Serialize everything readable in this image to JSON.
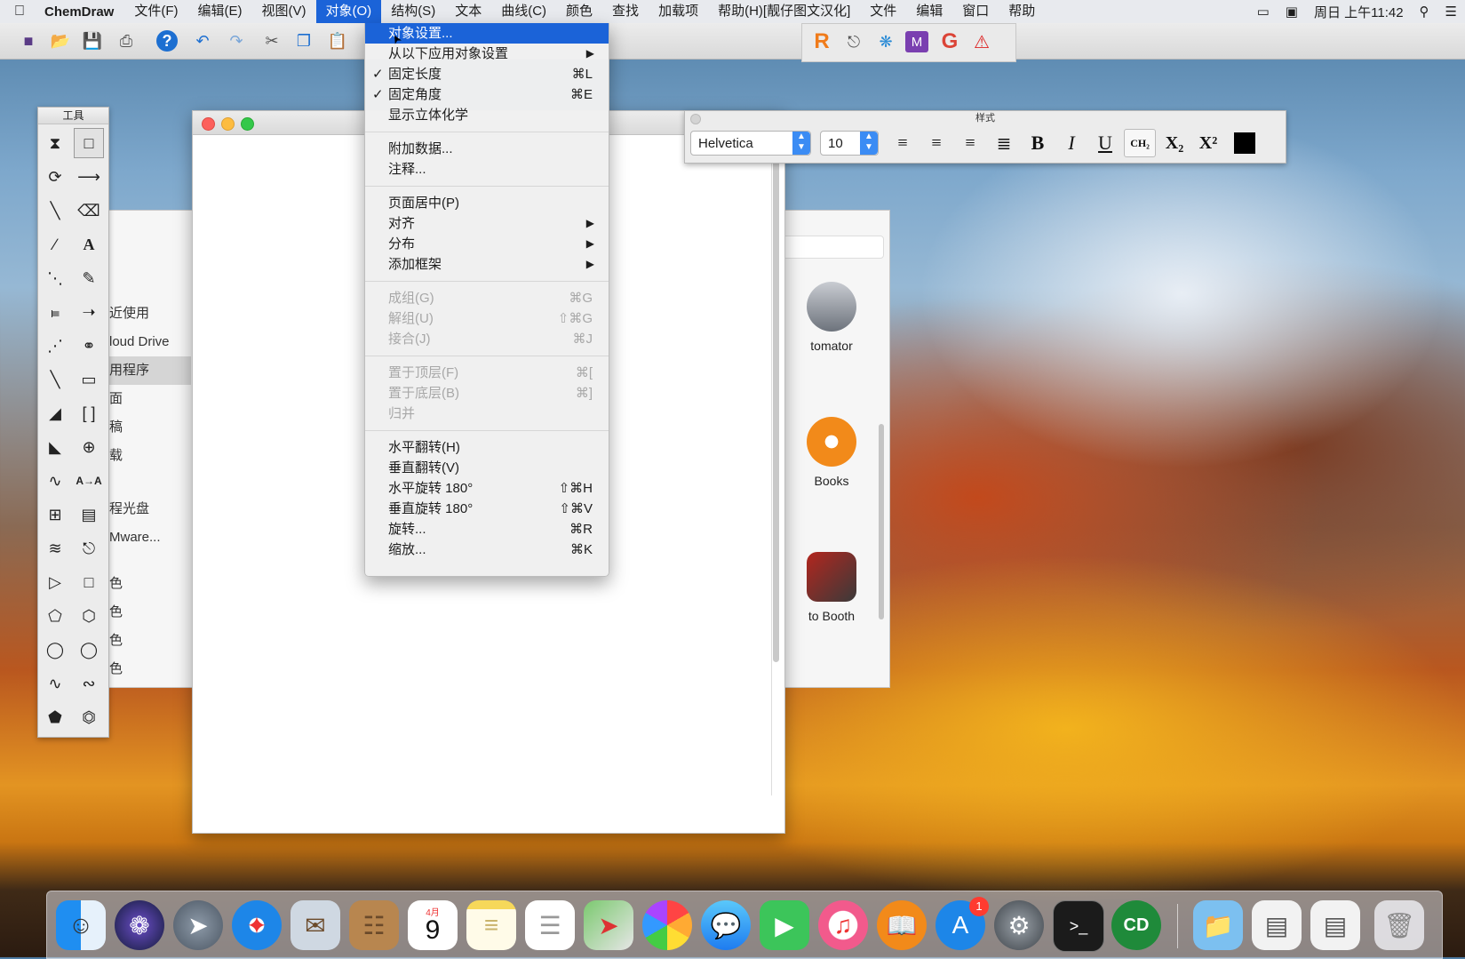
{
  "menubar": {
    "apple": "",
    "app_name": "ChemDraw",
    "items": [
      "文件(F)",
      "编辑(E)",
      "视图(V)",
      "对象(O)",
      "结构(S)",
      "文本",
      "曲线(C)",
      "颜色",
      "查找",
      "加载项",
      "帮助(H)[靓仔图文汉化]",
      "文件",
      "编辑",
      "窗口",
      "帮助"
    ],
    "active_index": 3,
    "clock": "周日 上午11:42"
  },
  "tools_palette": {
    "title": "工具"
  },
  "style_palette": {
    "title": "样式",
    "font": "Helvetica",
    "size": "10"
  },
  "finder": {
    "sidebar": [
      "近使用",
      "loud Drive",
      "用程序",
      "面",
      "稿",
      "载",
      "程光盘",
      "Mware...",
      "色",
      "色",
      "色",
      "色"
    ],
    "highlight_index": 2,
    "apps": [
      "tomator",
      "Books",
      "to Booth"
    ]
  },
  "object_menu": [
    {
      "label": "对象设置...",
      "shortcut": "",
      "highlighted": true
    },
    {
      "label": "从以下应用对象设置",
      "submenu": true
    },
    {
      "label": "固定长度",
      "shortcut": "⌘L",
      "checked": true
    },
    {
      "label": "固定角度",
      "shortcut": "⌘E",
      "checked": true
    },
    {
      "label": "显示立体化学",
      "shortcut": ""
    },
    {
      "separator": true
    },
    {
      "label": "附加数据...",
      "shortcut": ""
    },
    {
      "label": "注释...",
      "shortcut": ""
    },
    {
      "separator": true
    },
    {
      "label": "页面居中(P)",
      "shortcut": ""
    },
    {
      "label": "对齐",
      "submenu": true
    },
    {
      "label": "分布",
      "submenu": true
    },
    {
      "label": "添加框架",
      "submenu": true
    },
    {
      "separator": true
    },
    {
      "label": "成组(G)",
      "shortcut": "⌘G",
      "disabled": true
    },
    {
      "label": "解组(U)",
      "shortcut": "⇧⌘G",
      "disabled": true
    },
    {
      "label": "接合(J)",
      "shortcut": "⌘J",
      "disabled": true
    },
    {
      "separator": true
    },
    {
      "label": "置于顶层(F)",
      "shortcut": "⌘[",
      "disabled": true
    },
    {
      "label": "置于底层(B)",
      "shortcut": "⌘]",
      "disabled": true
    },
    {
      "label": "归并",
      "shortcut": "",
      "disabled": true
    },
    {
      "separator": true
    },
    {
      "label": "水平翻转(H)",
      "shortcut": ""
    },
    {
      "label": "垂直翻转(V)",
      "shortcut": ""
    },
    {
      "label": "水平旋转 180°",
      "shortcut": "⇧⌘H"
    },
    {
      "label": "垂直旋转 180°",
      "shortcut": "⇧⌘V"
    },
    {
      "label": "旋转...",
      "shortcut": "⌘R"
    },
    {
      "label": "缩放...",
      "shortcut": "⌘K"
    }
  ],
  "dock": {
    "calendar_month": "4月",
    "calendar_day": "9",
    "appstore_badge": "1",
    "chemdraw_label": "CD"
  },
  "colors": {
    "accent": "#1b63d8",
    "menu_bg": "#f0f0f0",
    "disabled": "#a8a8a8"
  }
}
